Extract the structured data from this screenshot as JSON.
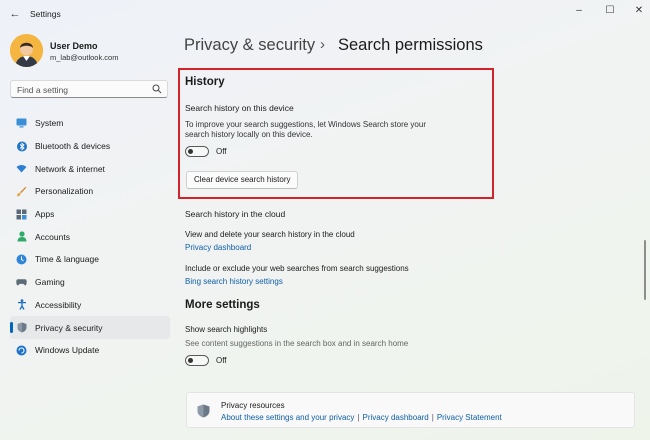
{
  "window": {
    "title": "Settings"
  },
  "user": {
    "name": "User Demo",
    "email": "m_lab@outlook.com"
  },
  "search": {
    "placeholder": "Find a setting"
  },
  "sidebar": {
    "items": [
      {
        "label": "System",
        "icon": "monitor-icon"
      },
      {
        "label": "Bluetooth & devices",
        "icon": "bluetooth-icon"
      },
      {
        "label": "Network & internet",
        "icon": "wifi-icon"
      },
      {
        "label": "Personalization",
        "icon": "brush-icon"
      },
      {
        "label": "Apps",
        "icon": "apps-icon"
      },
      {
        "label": "Accounts",
        "icon": "person-icon"
      },
      {
        "label": "Time & language",
        "icon": "globe-clock-icon"
      },
      {
        "label": "Gaming",
        "icon": "gamepad-icon"
      },
      {
        "label": "Accessibility",
        "icon": "accessibility-icon"
      },
      {
        "label": "Privacy & security",
        "icon": "shield-icon",
        "active": true
      },
      {
        "label": "Windows Update",
        "icon": "update-icon"
      }
    ]
  },
  "breadcrumb": {
    "parent": "Privacy & security",
    "separator": "›",
    "current": "Search permissions"
  },
  "history": {
    "title": "History",
    "device_label": "Search history on this device",
    "device_desc": "To improve your search suggestions, let Windows Search store your search history locally on this device.",
    "toggle_state": "Off",
    "clear_button": "Clear device search history"
  },
  "cloud": {
    "heading": "Search history in the cloud",
    "view_desc": "View and delete your search history in the cloud",
    "privacy_dashboard_link": "Privacy dashboard",
    "include_desc": "Include or exclude your web searches from search suggestions",
    "bing_link": "Bing search history settings"
  },
  "more": {
    "title": "More settings",
    "highlights_label": "Show search highlights",
    "highlights_desc": "See content suggestions in the search box and in search home",
    "toggle_state": "Off"
  },
  "resources": {
    "title": "Privacy resources",
    "links": [
      "About these settings and your privacy",
      "Privacy dashboard",
      "Privacy Statement"
    ],
    "separator": "|"
  },
  "colors": {
    "accent": "#0067c0",
    "link": "#0f5fa8",
    "highlight_border": "#d3232a"
  }
}
